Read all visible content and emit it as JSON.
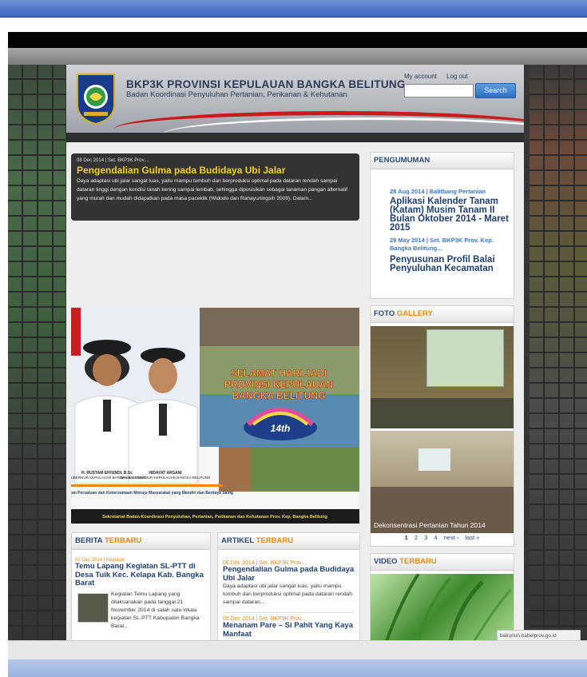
{
  "header": {
    "site_title": "BKP3K PROVINSI KEPULAUAN BANGKA BELITUNG",
    "site_subtitle": "Badan Koordinasi Penyuluhan Pertanian, Perikanan & Kehutanan",
    "my_account": "My account",
    "log_out": "Log out",
    "search_label": "Search",
    "search_value": ""
  },
  "feature": {
    "meta": "08 Dec 2014 | Set. BKP3K Prov....",
    "title": "Pengendalian Gulma pada Budidaya Ubi Jalar",
    "text": "Daya adaptasi ubi jalar sangat luas, yaitu mampu tumbuh dan berproduksi optimal pada dataran rendah sampai dataran tinggi dengan kondisi tanah kering sampai lembab, sehingga diposisikan sebagai tanaman pangan alternatif yang murah dan mudah didapatkan pada masa paceklik (Widodo dan Rahayuningsih 2009). Dalam..."
  },
  "pengumuman": {
    "heading": "PENGUMUMAN",
    "items": [
      {
        "meta": "28 Aug 2014 | Balitbang Pertanian",
        "title": "Aplikasi Kalender Tanam (Katam) Musim Tanam II Bulan Oktober 2014 - Maret 2015"
      },
      {
        "meta": "29 May 2014 | Set. BKP3K Prov. Kep. Bangka Belitung...",
        "title": "Penyusunan Profil Balai Penyuluhan Kecamatan"
      }
    ]
  },
  "banner": {
    "greeting": "SELAMAT HARI JADI PROVINSI KEPULAUAN BANGKA BELITUNG",
    "anniversary": "14th",
    "person1_name": "H. RUSTAM EFFENDI, B.Sc",
    "person1_role": "GUBERNUR KEPULAUAN BANGKA BELITUNG",
    "person2_name": "HIDAYAT ARSANI",
    "person2_role": "WAKIL GUBERNUR KEPULAUAN BANGKA BELITUNG",
    "slogan": "Kuatkan Persatuan dan Kebersamaan Menuju Masyarakat yang Mandiri dan Berdaya Saing",
    "footer": "Sekretariat Badan Koordinasi Penyuluhan, Pertanian, Perikanan dan Kehutanan Prov. Kep. Bangka Belitung"
  },
  "gallery": {
    "heading_a": "FOTO ",
    "heading_b": "GALLERY",
    "caption": "Dekonsentrasi Pertanian Tahun 2014",
    "pages": [
      "1",
      "2",
      "3",
      "4",
      "next ›",
      "last »"
    ]
  },
  "berita": {
    "heading_a": "BERITA ",
    "heading_b": "TERBARU",
    "meta": "02 Dec 2014 | Kegiatan",
    "title": "Temu Lapang Kegiatan SL-PTT di Desa Tuik Kec. Kelapa Kab. Bangka Barat",
    "text": "Kegiatan Temu Lapang yang dilaksanakan pada tanggal 21 November 2014 di salah satu lokasi kegiatan SL-PTT Kabupaten Bangka Barat..."
  },
  "artikel": {
    "heading_a": "ARTIKEL ",
    "heading_b": "TERBARU",
    "items": [
      {
        "meta": "08 Dec 2014 | Set. BKP3K Prov....",
        "title": "Pengendalian Gulma pada Budidaya Ubi Jalar",
        "text": "Daya adaptasi ubi jalar sangat luas, yaitu mampu tumbuh dan berproduksi optimal pada dataran rendah sampai dataran..."
      },
      {
        "meta": "05 Dec 2014 | Set. BKP3K Prov....",
        "title": "Menanam Pare – Si Pahit Yang Kaya Manfaat"
      }
    ]
  },
  "video": {
    "heading_a": "VIDEO ",
    "heading_b": "TERBARU"
  },
  "status": {
    "url": "bakorluh.babelprov.go.id"
  },
  "colors": {
    "accent": "#e58a12",
    "heading_blue": "#2c4a78",
    "feature_title": "#f2ce1e",
    "brand_red": "#c81b1b"
  }
}
